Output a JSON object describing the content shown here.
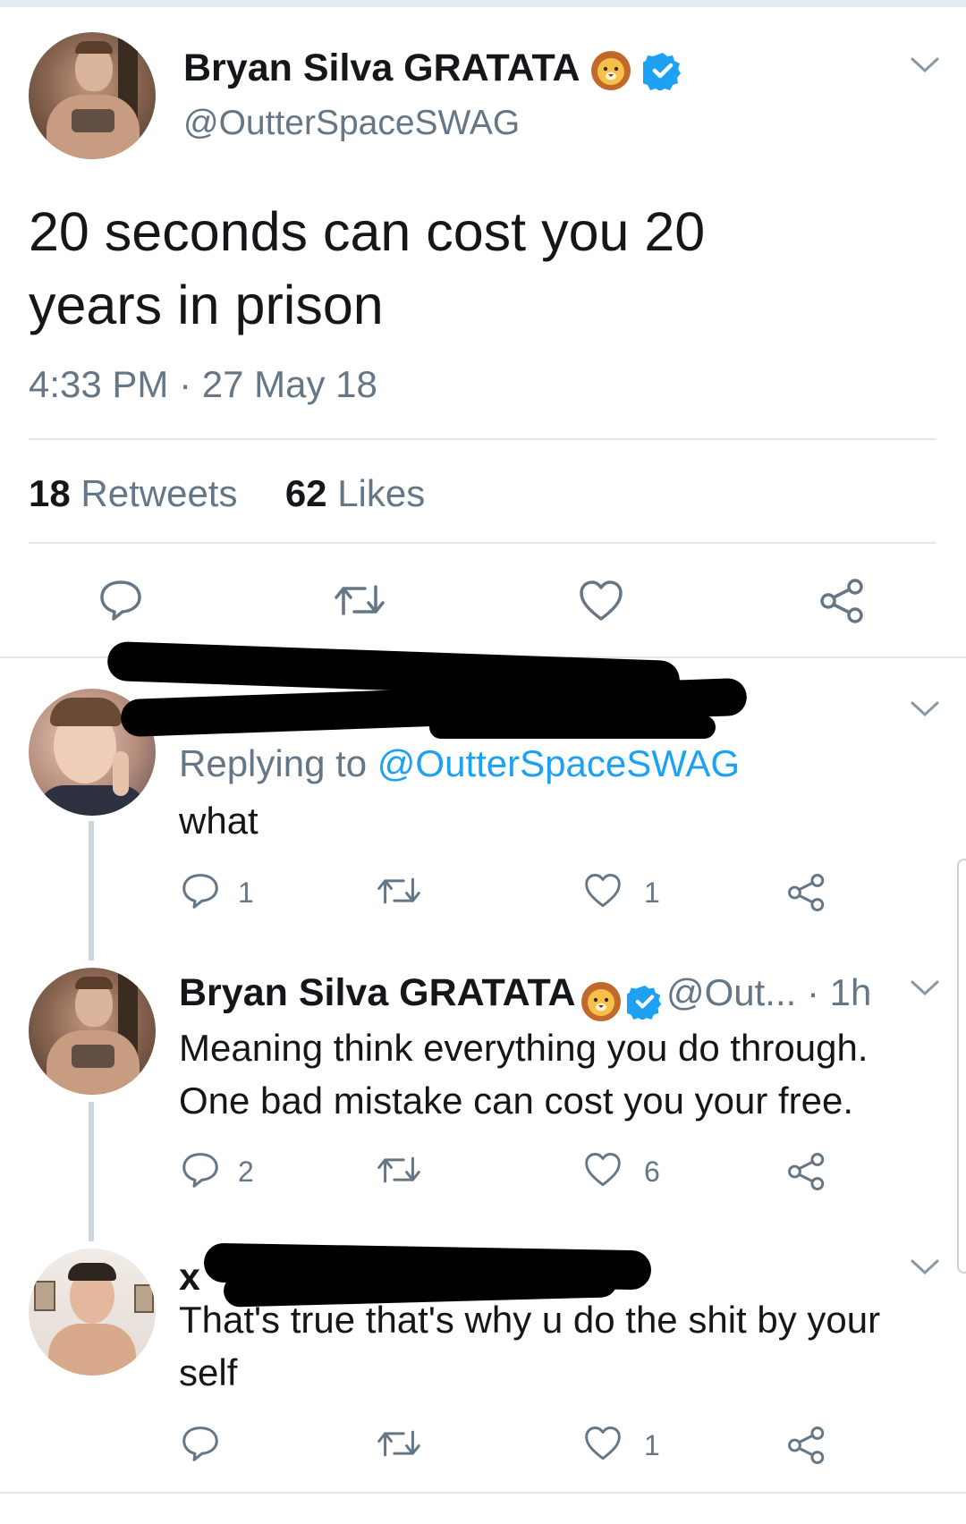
{
  "main_tweet": {
    "name": "Bryan Silva GRATATA",
    "handle": "@OutterSpaceSWAG",
    "text_line1": "20 seconds can cost you 20",
    "text_line2": "years in prison",
    "timestamp": "4:33 PM · 27 May 18",
    "retweets_count": "18",
    "retweets_label": "Retweets",
    "likes_count": "62",
    "likes_label": "Likes"
  },
  "reply1": {
    "replying_prefix": "Replying to",
    "replying_handle": "@OutterSpaceSWAG",
    "text": "what",
    "reply_count": "1",
    "like_count": "1"
  },
  "reply2": {
    "name": "Bryan Silva GRATATA",
    "handle_time": "@Out... · 1h",
    "text_line1": "Meaning think everything you do through.",
    "text_line2": "One bad mistake can cost you your free.",
    "reply_count": "2",
    "like_count": "6"
  },
  "reply3": {
    "name_fragment": "x",
    "text_line1": "That's true that's why u do the shit by your",
    "text_line2": "self",
    "like_count": "1"
  },
  "colors": {
    "verified_blue": "#1da1f2",
    "icon_gray": "#657786",
    "text": "#14171a",
    "divider": "#e1e8ed"
  },
  "icons": [
    "reply-icon",
    "retweet-icon",
    "like-icon",
    "share-icon",
    "chevron-down-icon",
    "verified-icon",
    "lion-emoji-icon"
  ]
}
